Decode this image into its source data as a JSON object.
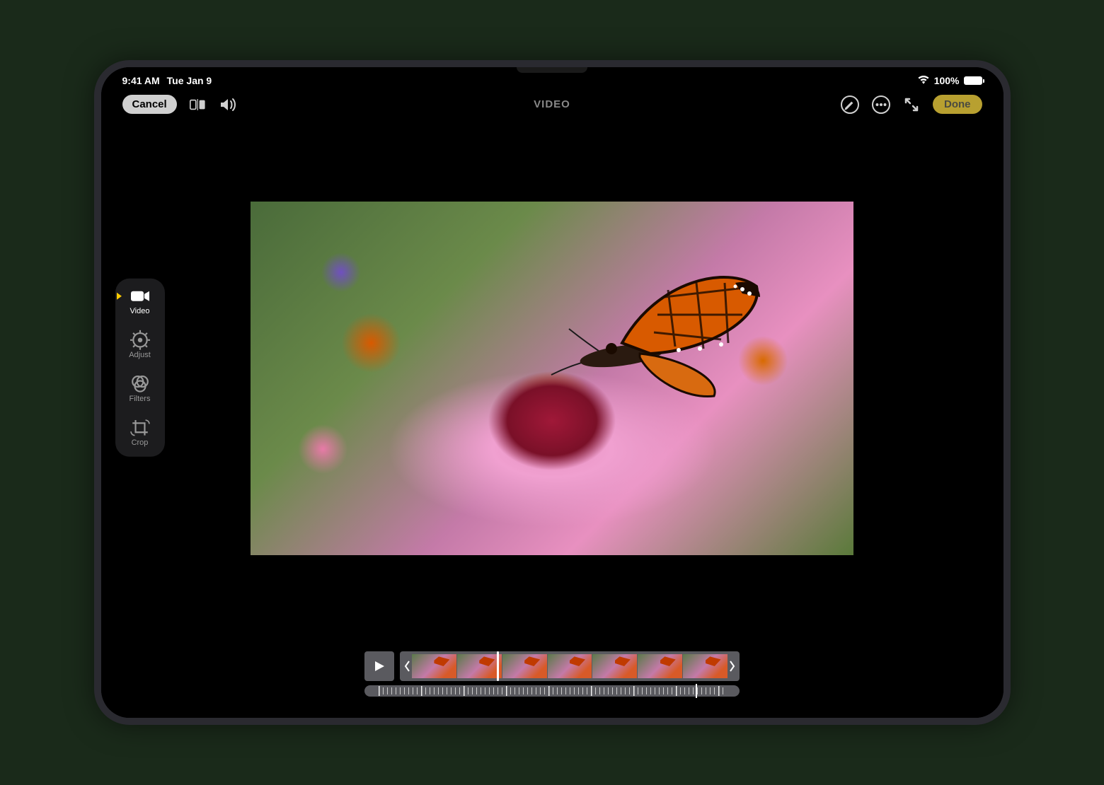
{
  "status": {
    "time": "9:41 AM",
    "date": "Tue Jan 9",
    "battery_pct": "100%"
  },
  "toolbar": {
    "cancel_label": "Cancel",
    "title": "VIDEO",
    "done_label": "Done"
  },
  "sidebar": {
    "items": [
      {
        "id": "video",
        "label": "Video",
        "icon": "video-camera-icon",
        "active": true
      },
      {
        "id": "adjust",
        "label": "Adjust",
        "icon": "adjust-dial-icon",
        "active": false
      },
      {
        "id": "filters",
        "label": "Filters",
        "icon": "three-circles-icon",
        "active": false
      },
      {
        "id": "crop",
        "label": "Crop",
        "icon": "crop-rotate-icon",
        "active": false
      }
    ]
  },
  "preview": {
    "description": "Monarch butterfly resting on a pink zinnia flower with blurred garden background"
  },
  "colors": {
    "accent": "#ffcc00",
    "done_button": "#b8a030",
    "panel": "#1c1c1e",
    "scrubber_bg": "#5a5a5f"
  }
}
